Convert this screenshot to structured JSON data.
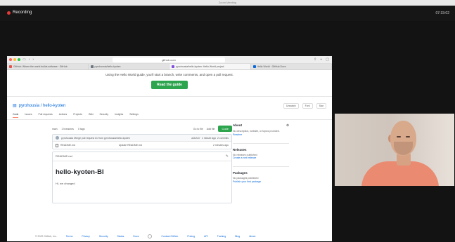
{
  "window": {
    "title": "Zoom Meeting",
    "recording_label": "Recording",
    "clock": "07:33:02"
  },
  "browser": {
    "address": "github.com",
    "tabs": [
      {
        "label": "GitHub: Where the world builds software · GitHub",
        "color": "#e5534b"
      },
      {
        "label": "pyrohousia/hello-kyoten",
        "color": "#6e7781"
      },
      {
        "label": "pyrohousia/hello-kyoten: Hello World project",
        "color": "#8250df"
      },
      {
        "label": "Hello World · GitHub Docs",
        "color": "#0969da"
      }
    ]
  },
  "banner": {
    "text": "Using the Hello World guide, you'll start a branch, write comments, and open a pull request.",
    "button": "Read the guide"
  },
  "repo": {
    "name": "pyrohousia / hello-kyoten",
    "actions": [
      "Unwatch",
      "Fork",
      "Star"
    ],
    "tabs": [
      "Code",
      "Issues",
      "Pull requests",
      "Actions",
      "Projects",
      "Wiki",
      "Security",
      "Insights",
      "Settings"
    ]
  },
  "filebar": {
    "left": [
      "main",
      "2 branches",
      "0 tags"
    ],
    "right": [
      "Go to file",
      "Add file"
    ],
    "code_button": "Code"
  },
  "files": {
    "commit": {
      "author": "pyrohousia",
      "message": "Merge pull request #1 from pyrohousia/hello-kyoten",
      "meta": "a1b2c3 · 1 minute ago",
      "count": "2 commits"
    },
    "rows": [
      {
        "name": "README.md",
        "message": "Update README.md",
        "time": "2 minutes ago"
      }
    ]
  },
  "readme": {
    "label": "README.md",
    "heading": "hello-kyoten-BI",
    "text": "Hi, we changed"
  },
  "about": {
    "title": "About",
    "description": "No description, website, or topics provided.",
    "readme_link": "Readme",
    "releases_title": "Releases",
    "releases_text": "No releases published",
    "releases_link": "Create a new release",
    "packages_title": "Packages",
    "packages_text": "No packages published",
    "packages_link": "Publish your first package"
  },
  "footer": {
    "copyright": "© 2022 GitHub, Inc.",
    "links": [
      "Terms",
      "Privacy",
      "Security",
      "Status",
      "Docs",
      "Contact GitHub",
      "Pricing",
      "API",
      "Training",
      "Blog",
      "About"
    ]
  }
}
